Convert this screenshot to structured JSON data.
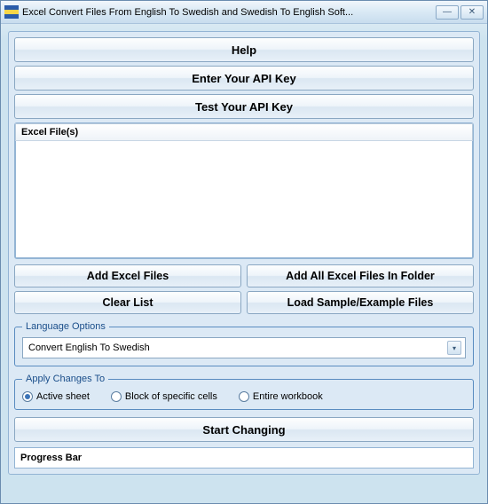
{
  "window": {
    "title": "Excel Convert Files From English To Swedish and Swedish To English Soft..."
  },
  "topButtons": {
    "help": "Help",
    "enterKey": "Enter Your API Key",
    "testKey": "Test Your API Key"
  },
  "list": {
    "header": "Excel File(s)"
  },
  "fileButtons": {
    "add": "Add Excel Files",
    "addFolder": "Add All Excel Files In Folder",
    "clear": "Clear List",
    "loadSample": "Load Sample/Example Files"
  },
  "languageOptions": {
    "legend": "Language Options",
    "selected": "Convert English To Swedish"
  },
  "applyChanges": {
    "legend": "Apply Changes To",
    "options": {
      "active": "Active sheet",
      "block": "Block of specific cells",
      "entire": "Entire workbook"
    },
    "selected": "active"
  },
  "start": {
    "label": "Start Changing"
  },
  "progress": {
    "label": "Progress Bar"
  }
}
